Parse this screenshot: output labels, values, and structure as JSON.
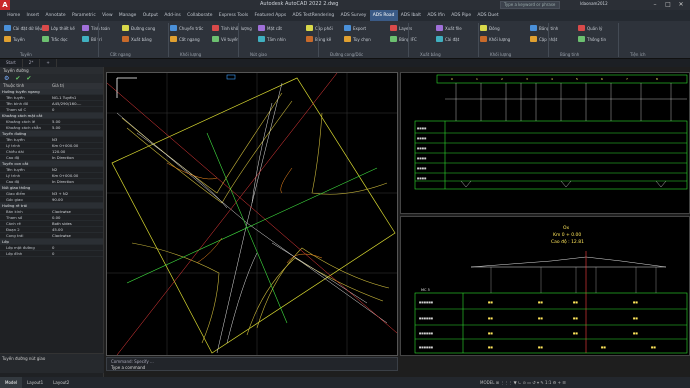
{
  "window": {
    "title": "Autodesk AutoCAD 2022   2.dwg",
    "search_placeholder": "Type a keyword or phrase",
    "user": "ldaonam2012",
    "min": "–",
    "max": "□",
    "close": "✕"
  },
  "app_logo": "A",
  "menu": {
    "tabs": [
      "Home",
      "Insert",
      "Annotate",
      "Parametric",
      "View",
      "Manage",
      "Output",
      "Add-ins",
      "Collaborate",
      "Express Tools",
      "Featured Apps",
      "ADS TestRendering",
      "ADS Survey",
      "ADS Road",
      "ADS Ibalt",
      "ADS Ifin",
      "ADS Pipe",
      "ADS Duet"
    ],
    "active": "ADS Road"
  },
  "ribbon": {
    "buttons": [
      "Cài đặt dữ liệu",
      "Tuyến",
      "Lớp thiết kế",
      "Trắc dọc",
      "Tính toán",
      "Bố trí",
      "Đường cong",
      "Xuất bảng",
      "Chuyển trắc",
      "Cắt ngang",
      "Tính khối lượng",
      "Vẽ tuyến",
      "Mặt cắt",
      "Tầm nhìn",
      "Cấp phối",
      "Bảng kê",
      "Export",
      "Tùy chọn",
      "Layers",
      "Bảng IFC",
      "Xuất file",
      "Cài đặt",
      "Đóng",
      "Khối lượng",
      "Bảng tính",
      "Cập nhật",
      "Quản lý",
      "Thông tin"
    ],
    "panels": [
      "Tuyến",
      "Cắt ngang",
      "Khối lượng",
      "Nút giao",
      "Đường cong/Dốc",
      "Xuất bảng",
      "Khối lượng",
      "Bảng tính",
      "Tiện ích"
    ]
  },
  "file_tabs": [
    "Start",
    "2*",
    "+"
  ],
  "palette": {
    "title": "Tuyến đường",
    "head": {
      "k": "Thuộc tính",
      "v": "Giá trị"
    },
    "rows": [
      {
        "k": "Hướng tuyến ngang",
        "v": "",
        "sec": true
      },
      {
        "k": "Tên tuyến",
        "v": "NG-1 Tuyến1"
      },
      {
        "k": "Tên bình đồ",
        "v": "A45/290/160-..."
      },
      {
        "k": "Tham số C",
        "v": "0"
      },
      {
        "k": "Khoảng cách mặt cắt",
        "v": "",
        "sec": true
      },
      {
        "k": "Khoảng cách lẻ",
        "v": "5.00"
      },
      {
        "k": "Khoảng cách chẵn",
        "v": "5.00"
      },
      {
        "k": "Tuyến đường",
        "v": "",
        "sec": true
      },
      {
        "k": "Tên tuyến",
        "v": "N3"
      },
      {
        "k": "Lý trình",
        "v": "Km 0+000.00"
      },
      {
        "k": "Chiều dài",
        "v": "120.00"
      },
      {
        "k": "Cao độ",
        "v": "In Direction"
      },
      {
        "k": "Tuyến con cắt",
        "v": "",
        "sec": true
      },
      {
        "k": "Tên tuyến",
        "v": "N2"
      },
      {
        "k": "Lý trình",
        "v": "Km 0+000.00"
      },
      {
        "k": "Cao độ",
        "v": "In Direction"
      },
      {
        "k": "Nút giao thông",
        "v": "",
        "sec": true
      },
      {
        "k": "Giao điểm",
        "v": "N3 + N2"
      },
      {
        "k": "Góc giao",
        "v": "90.00"
      },
      {
        "k": "Hướng rẽ trái",
        "v": "",
        "sec": true
      },
      {
        "k": "Bán kính",
        "v": "Clockwise"
      },
      {
        "k": "Tham số",
        "v": "0.00"
      },
      {
        "k": "Cánh rẽ",
        "v": "Both sides"
      },
      {
        "k": "Đoạn 2",
        "v": "45.00"
      },
      {
        "k": "Cong trái",
        "v": "Clockwise"
      },
      {
        "k": "Lớp",
        "v": "",
        "sec": true
      },
      {
        "k": "Lớp mặt đường",
        "v": "0"
      },
      {
        "k": "Lớp đỉnh",
        "v": "0"
      }
    ],
    "footer": "Tuyến đường nút giao"
  },
  "right_bottom": {
    "title": "Ox",
    "sub1": "Km 0 + 0.00",
    "sub2": "Cao độ : 12.81",
    "left_label": "MC 5"
  },
  "cmdline": {
    "history": "Command:  Specify ...",
    "input": "Type a command"
  },
  "status": {
    "tabs": [
      "Model",
      "Layout1",
      "Layout2"
    ],
    "active": "Model",
    "coords": "MODEL  ⊞  ⋮⋮⋮  ▼  ∟  ⊙  ▭  ↺  ⌖  ✎  1:1  ⚙  +  ☰"
  }
}
